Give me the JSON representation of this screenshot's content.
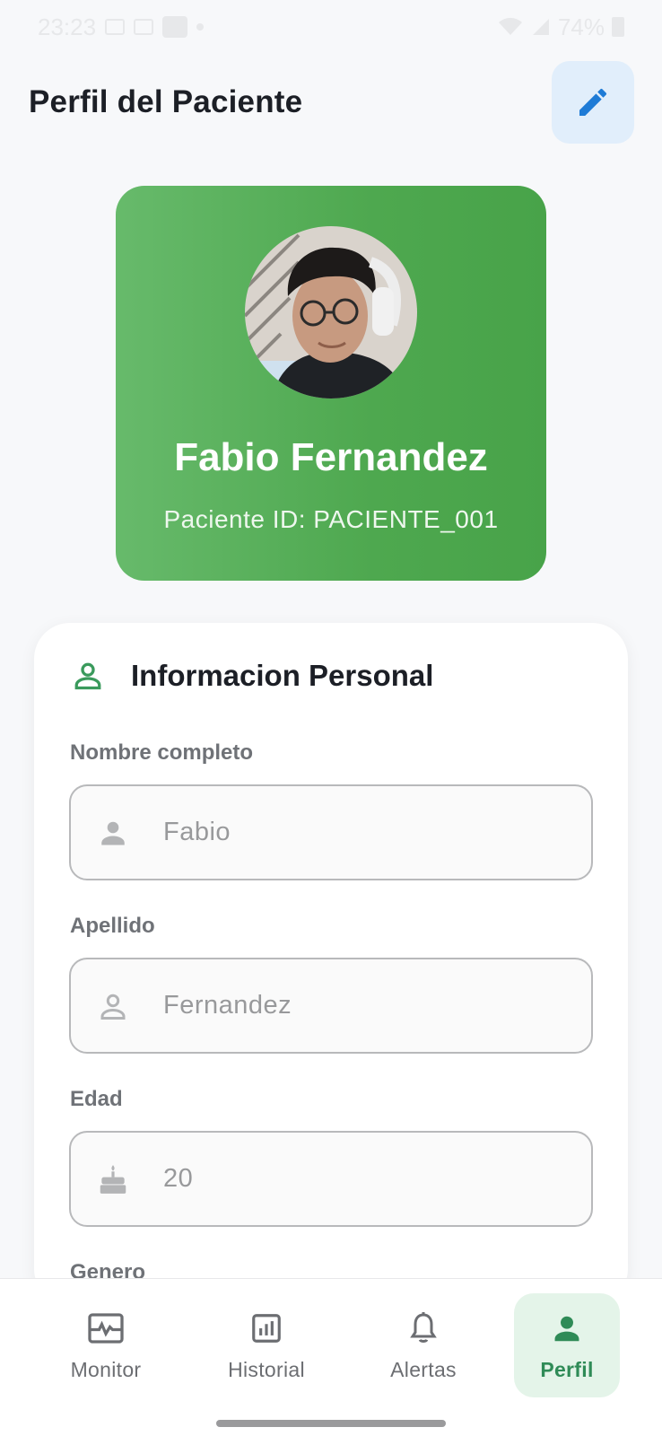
{
  "status_bar": {
    "time": "23:23",
    "battery": "74%"
  },
  "header": {
    "title": "Perfil del Paciente",
    "edit_icon": "pencil-icon"
  },
  "profile": {
    "name": "Fabio Fernandez",
    "patient_id": "Paciente ID: PACIENTE_001",
    "accent_color": "#4ea84f"
  },
  "personal_info": {
    "title": "Informacion Personal",
    "icon": "person-outline-icon",
    "fields": [
      {
        "label": "Nombre completo",
        "value": "Fabio",
        "icon": "person-icon"
      },
      {
        "label": "Apellido",
        "value": "Fernandez",
        "icon": "person-outline-icon"
      },
      {
        "label": "Edad",
        "value": "20",
        "icon": "cake-icon"
      },
      {
        "label": "Genero",
        "value": "",
        "icon": ""
      }
    ]
  },
  "bottom_nav": {
    "items": [
      {
        "label": "Monitor",
        "icon": "heart-monitor-icon",
        "active": false
      },
      {
        "label": "Historial",
        "icon": "bar-chart-icon",
        "active": false
      },
      {
        "label": "Alertas",
        "icon": "bell-icon",
        "active": false
      },
      {
        "label": "Perfil",
        "icon": "person-icon",
        "active": true
      }
    ],
    "active_color": "#2f8b57"
  }
}
